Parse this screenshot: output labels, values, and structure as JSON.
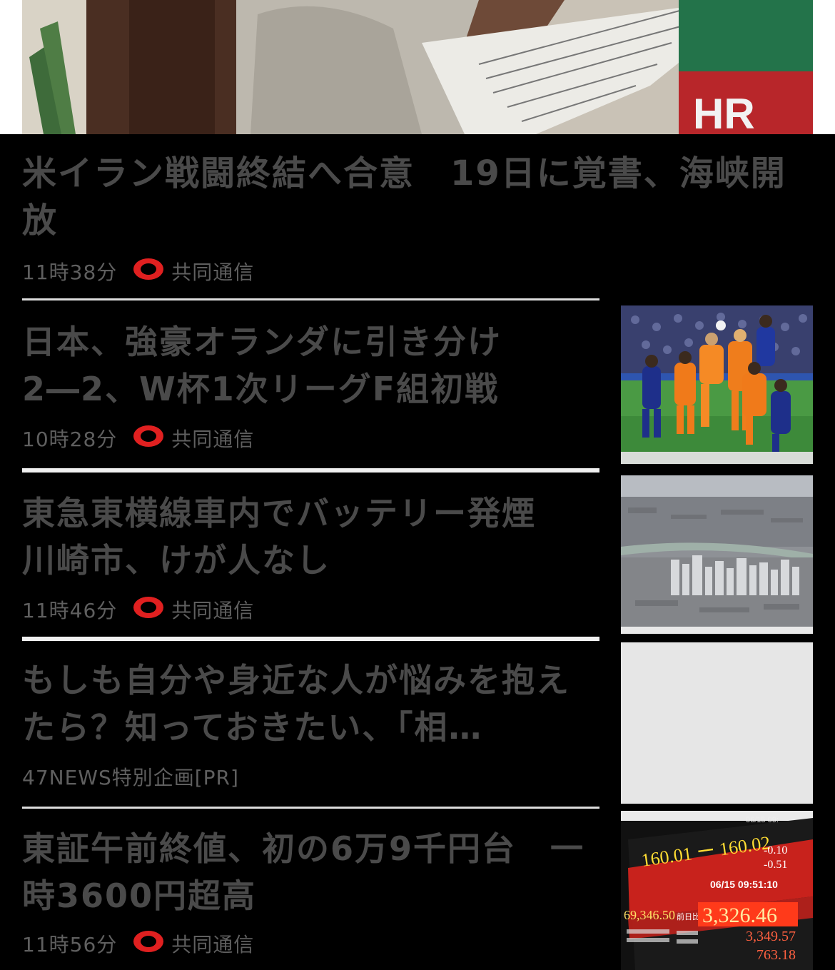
{
  "feature": {
    "title": "米イラン戦闘終結へ合意　19日に覚書、海峡開放",
    "time": "11時38分",
    "source": "共同通信"
  },
  "articles": [
    {
      "title": "日本、強豪オランダに引き分け2―2、W杯1次リーグF組初戦",
      "time": "10時28分",
      "source": "共同通信",
      "thumb_icon": "soccer-match-photo"
    },
    {
      "title": "東急東横線車内でバッテリー発煙　川崎市、けが人なし",
      "time": "11時46分",
      "source": "共同通信",
      "thumb_icon": "city-aerial-photo"
    },
    {
      "title": "もしも自分や身近な人が悩みを抱えたら？知っておきたい、「相…",
      "sponsor": "47NEWS特別企画[PR]",
      "thumb_icon": "placeholder-image"
    },
    {
      "title": "東証午前終値、初の6万9千円台　一時3600円超高",
      "time": "11時56分",
      "source": "共同通信",
      "thumb_icon": "stock-board-photo"
    }
  ],
  "stock_board": {
    "date1": "06/15 09:",
    "range": "160.01 ー 160.02",
    "chg1": "-0.10",
    "chg2": "-0.51",
    "date2": "06/15 09:51:10",
    "nikkei": "69,346.50",
    "label": "前日比",
    "value": "3,326.46",
    "v2": "3,349.57",
    "v3": "763.18"
  },
  "colors": {
    "background": "#000000",
    "title_text": "#4a4a4a",
    "meta_text": "#5f5f5f",
    "source_logo_red": "#e02020",
    "divider": "#dcdcdc"
  }
}
